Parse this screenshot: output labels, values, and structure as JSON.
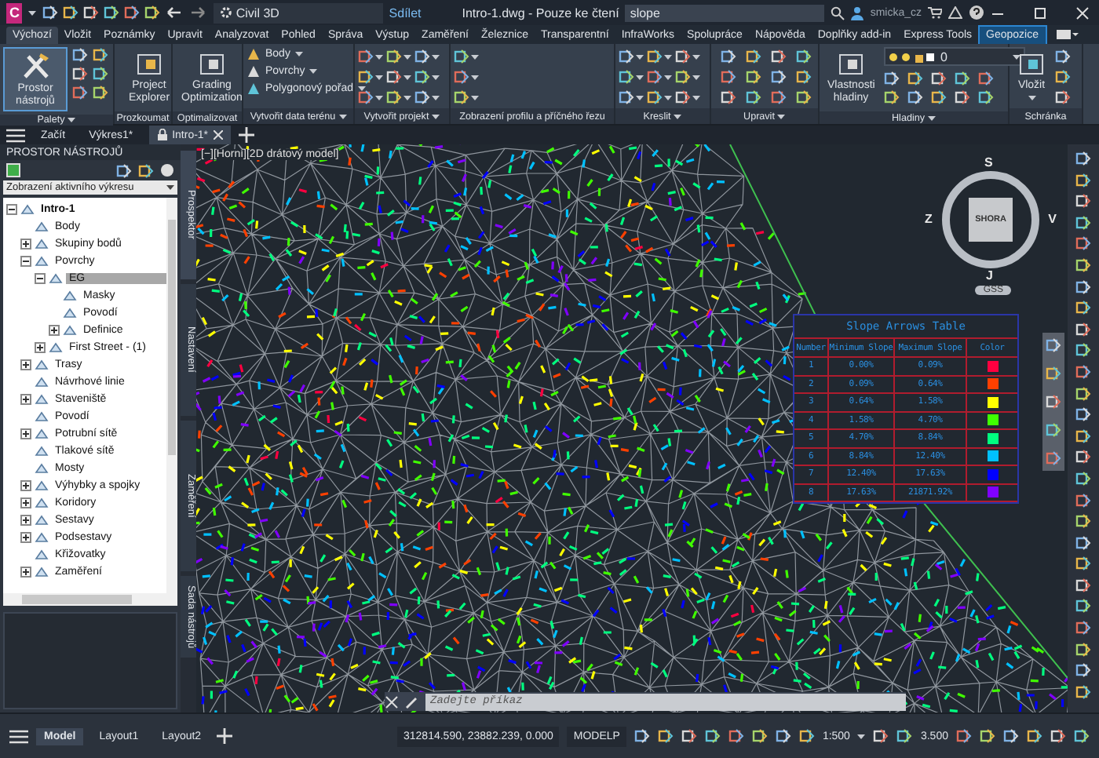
{
  "title_bar": {
    "app_letter": "C",
    "workspace": "Civil 3D",
    "share": "Sdílet",
    "title": "Intro-1.dwg - Pouze ke čtení",
    "search": "slope",
    "user": "smicka_cz"
  },
  "ribbon_tabs": [
    {
      "label": "Výchozí",
      "selected": true,
      "contextual": false
    },
    {
      "label": "Vložit",
      "selected": false,
      "contextual": false
    },
    {
      "label": "Poznámky",
      "selected": false,
      "contextual": false
    },
    {
      "label": "Upravit",
      "selected": false,
      "contextual": false
    },
    {
      "label": "Analyzovat",
      "selected": false,
      "contextual": false
    },
    {
      "label": "Pohled",
      "selected": false,
      "contextual": false
    },
    {
      "label": "Správa",
      "selected": false,
      "contextual": false
    },
    {
      "label": "Výstup",
      "selected": false,
      "contextual": false
    },
    {
      "label": "Zaměření",
      "selected": false,
      "contextual": false
    },
    {
      "label": "Železnice",
      "selected": false,
      "contextual": false
    },
    {
      "label": "Transparentní",
      "selected": false,
      "contextual": false
    },
    {
      "label": "InfraWorks",
      "selected": false,
      "contextual": false
    },
    {
      "label": "Spolupráce",
      "selected": false,
      "contextual": false
    },
    {
      "label": "Nápověda",
      "selected": false,
      "contextual": false
    },
    {
      "label": "Doplňky add-in",
      "selected": false,
      "contextual": false
    },
    {
      "label": "Express Tools",
      "selected": false,
      "contextual": false
    },
    {
      "label": "Geopozice",
      "selected": false,
      "contextual": true
    }
  ],
  "ribbon_panels": [
    {
      "label": "Palety",
      "menu": true,
      "kind": "palettes",
      "button": {
        "label": "Prostor nástrojů",
        "selected": true
      }
    },
    {
      "label": "Prozkoumat",
      "menu": false,
      "kind": "large",
      "button": {
        "label": "Project Explorer",
        "selected": false
      }
    },
    {
      "label": "Optimalizovat",
      "menu": false,
      "kind": "large",
      "button": {
        "label": "Grading Optimization",
        "selected": false
      }
    },
    {
      "label": "Vytvořit data terénu",
      "menu": true,
      "kind": "list",
      "items": [
        "Body",
        "Povrchy",
        "Polygonový pořad"
      ]
    },
    {
      "label": "Vytvořit projekt",
      "menu": true,
      "kind": "grid"
    },
    {
      "label": "Zobrazení profilu a příčného řezu",
      "menu": false,
      "kind": "column"
    },
    {
      "label": "Kreslit",
      "menu": true,
      "kind": "grid"
    },
    {
      "label": "Upravit",
      "menu": true,
      "kind": "grid4"
    },
    {
      "label": "Hladiny",
      "menu": true,
      "kind": "layers",
      "button": {
        "label": "Vlastnosti hladiny",
        "selected": false
      },
      "layer": "0"
    },
    {
      "label": "Schránka",
      "menu": false,
      "kind": "clipboard",
      "button": {
        "label": "Vložit",
        "selected": false
      }
    }
  ],
  "document_tabs": [
    {
      "label": "Začít",
      "selected": false,
      "locked": false
    },
    {
      "label": "Výkres1*",
      "selected": false,
      "locked": false
    },
    {
      "label": "Intro-1*",
      "selected": true,
      "locked": true
    }
  ],
  "left_panel": {
    "title": "PROSTOR NÁSTROJŮ",
    "view": "Zobrazení aktivního výkresu",
    "tree": [
      {
        "label": "Intro-1",
        "selected": false,
        "expanded": true,
        "children": [
          {
            "label": "Body",
            "selected": false
          },
          {
            "label": "Skupiny bodů",
            "selected": false,
            "expanded": false
          },
          {
            "label": "Povrchy",
            "selected": false,
            "expanded": true,
            "children": [
              {
                "label": "EG",
                "selected": true,
                "expanded": true,
                "children": [
                  {
                    "label": "Masky",
                    "selected": false
                  },
                  {
                    "label": "Povodí",
                    "selected": false
                  },
                  {
                    "label": "Definice",
                    "selected": false,
                    "expanded": false
                  }
                ]
              },
              {
                "label": "First Street - (1)",
                "selected": false,
                "expanded": false
              }
            ]
          },
          {
            "label": "Trasy",
            "selected": false,
            "expanded": false
          },
          {
            "label": "Návrhové linie",
            "selected": false
          },
          {
            "label": "Staveniště",
            "selected": false,
            "expanded": false
          },
          {
            "label": "Povodí",
            "selected": false
          },
          {
            "label": "Potrubní sítě",
            "selected": false,
            "expanded": false
          },
          {
            "label": "Tlakové sítě",
            "selected": false
          },
          {
            "label": "Mosty",
            "selected": false
          },
          {
            "label": "Výhybky a spojky",
            "selected": false,
            "expanded": false
          },
          {
            "label": "Koridory",
            "selected": false,
            "expanded": false
          },
          {
            "label": "Sestavy",
            "selected": false,
            "expanded": false
          },
          {
            "label": "Podsestavy",
            "selected": false,
            "expanded": false
          },
          {
            "label": "Křižovatky",
            "selected": false
          },
          {
            "label": "Zaměření",
            "selected": false,
            "expanded": false
          }
        ]
      }
    ],
    "side_tabs": [
      {
        "label": "Prospektor",
        "selected": true
      },
      {
        "label": "Nastavení",
        "selected": false
      },
      {
        "label": "Zaměření",
        "selected": false
      },
      {
        "label": "Sada nástrojů",
        "selected": false
      }
    ]
  },
  "viewport": {
    "label": "[−][Horní][2D drátový model]",
    "ucs": "GSS",
    "view_cube": {
      "face": "SHORA",
      "north": "S",
      "east": "V",
      "south": "J",
      "west": "Z"
    },
    "slope_table": {
      "title": "Slope Arrows Table",
      "columns": [
        "Number",
        "Minimum Slope",
        "Maximum Slope",
        "Color"
      ],
      "rows": [
        {
          "number": "1",
          "min": "0.00%",
          "max": "0.09%",
          "color": "#ff0040"
        },
        {
          "number": "2",
          "min": "0.09%",
          "max": "0.64%",
          "color": "#ff4000"
        },
        {
          "number": "3",
          "min": "0.64%",
          "max": "1.58%",
          "color": "#ffff00"
        },
        {
          "number": "4",
          "min": "1.58%",
          "max": "4.70%",
          "color": "#40ff00"
        },
        {
          "number": "5",
          "min": "4.70%",
          "max": "8.84%",
          "color": "#00ff80"
        },
        {
          "number": "6",
          "min": "8.84%",
          "max": "12.40%",
          "color": "#00c0ff"
        },
        {
          "number": "7",
          "min": "12.40%",
          "max": "17.63%",
          "color": "#0000ff"
        },
        {
          "number": "8",
          "min": "17.63%",
          "max": "21871.92%",
          "color": "#8000ff"
        }
      ]
    },
    "command_placeholder": "Zadejte příkaz"
  },
  "status_bar": {
    "layout_tabs": [
      {
        "label": "Model",
        "selected": true
      },
      {
        "label": "Layout1",
        "selected": false
      },
      {
        "label": "Layout2",
        "selected": false
      }
    ],
    "coordinates": "312814.590, 23882.239, 0.000",
    "space": "MODELP",
    "scale": "1:500",
    "annotation_scale": "3.500"
  }
}
